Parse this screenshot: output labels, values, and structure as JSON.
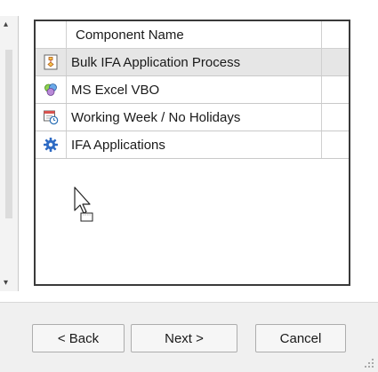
{
  "list": {
    "header": "Component Name",
    "rows": [
      {
        "name": "Bulk IFA Application Process",
        "icon": "process-icon",
        "selected": true
      },
      {
        "name": "MS Excel VBO",
        "icon": "business-object-icon",
        "selected": false
      },
      {
        "name": "Working Week / No Holidays",
        "icon": "calendar-clock-icon",
        "selected": false
      },
      {
        "name": "IFA Applications",
        "icon": "gear-icon",
        "selected": false
      }
    ]
  },
  "footer": {
    "back_label": "< Back",
    "next_label": "Next >",
    "cancel_label": "Cancel"
  },
  "colors": {
    "selected_row": "#e6e6e6",
    "grid_border": "#3a3a3a",
    "footer_bg": "#f0f0f0"
  }
}
